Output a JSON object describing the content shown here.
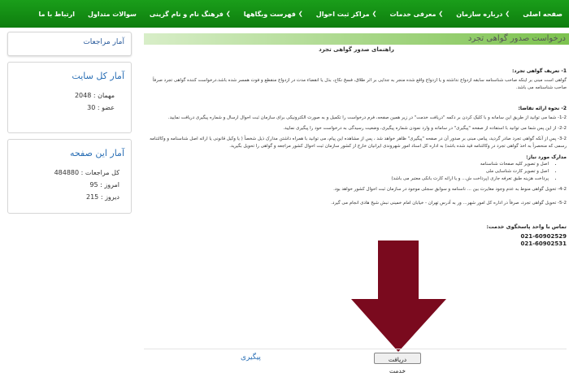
{
  "nav": {
    "items": [
      {
        "label": "صفحه اصلی",
        "chevron": false
      },
      {
        "label": "درباره سازمان",
        "chevron": true
      },
      {
        "label": "معرفی خدمات",
        "chevron": true
      },
      {
        "label": "مراکز ثبت احوال",
        "chevron": true
      },
      {
        "label": "فهرست وبگاهها",
        "chevron": true
      },
      {
        "label": "فرهنگ نام و نام گزینی",
        "chevron": true
      },
      {
        "label": "سوالات متداول",
        "chevron": false
      },
      {
        "label": "ارتباط با ما",
        "chevron": false
      }
    ],
    "color": "#129012"
  },
  "sidebar": {
    "visits_title": "آمار مراجعات",
    "site_stats": {
      "title": "آمار کل سایت",
      "guests_label": "مهمان :",
      "guests_value": "2048",
      "members_label": "عضو :",
      "members_value": "30"
    },
    "page_stats": {
      "title": "آمار این صفحه",
      "total_label": "کل مراجعات :",
      "total_value": "484880",
      "today_label": "امروز :",
      "today_value": "95",
      "yesterday_label": "دیروز :",
      "yesterday_value": "215"
    }
  },
  "main": {
    "title": "درخواست صدور گواهی تجرد",
    "subtitle": "راهنمای صدور گواهی تجرد",
    "s1_title": "1- تعریف گواهی تجرد:",
    "s1_text": "گواهی است مبنی بر اینکه صاحب شناسنامه سابقه ازدواج نداشته و یا ازدواج واقع شده منجر به جدایی بر اثر طلاق، فسخ نکاح، بذل یا انقضاء مدت در ازدواج منقطع و فوت همسر شده باشد.درخواست کننده گواهی تجرد صرفاً صاحب شناسنامه می باشد.",
    "s2_title": "2- نحوه ارائه تقاضا:",
    "s21": "1-2- شما می توانید از طریق این سامانه و با کلیک کردن بر دکمه \"دریافت خدمت\" در زیر همین صفحه، فرم درخواست را تکمیل و به صورت الکترونیکی برای سازمان ثبت احوال ارسال و شماره پیگیری دریافت نمایید.",
    "s22": "2-2- از این پس شما می توانید با استفاده از صفحه \"پیگیری\" در سامانه و وارد نمودن شماره پیگیری، وضعیت رسیدگی به درخواست خود را پیگیری نمایید.",
    "s23": "3-2- پس از آنکه گواهی تجرد صادر گردید، پیامی مبنی بر صدور آن در صفحه \"پیگیری\" ظاهر خواهد شد ، پس از مشاهده این پیام، می توانید با همراه داشتن مدارک ذیل شخصاً ( یا وکیل قانونی یا ارائه اصل شناسنامه و وکالتنامه رسمی که منحصراً به اخذ گواهی تجرد در وکالتنامه قید شده باشد) به اداره کل اسناد امور شهروندی ایرانیان خارج از کشور سازمان ثبت احوال کشور مراجعه و گواهی را تحویل بگیرید.",
    "docs_title": "مدارک مورد نیاز:",
    "docs": [
      "اصل و تصویر کلیه صفحات شناسنامه",
      "اصل و تصویر کارت شناسایی ملی",
      "پرداخت هزینه طبق تعرفه جاری (پرداخت ش... و یا ارائه کارت بانکی معتبر می باشد)"
    ],
    "s24": "4-2- تحویل گواهی منوط به عدم وجود مغایرت بین ... ناسنامه و سوابق سجلی موجود در سازمان ثبت احوال کشور خواهد بود.",
    "s25": "5-2- تحویل گواهی تجرد، صرفاً در اداره کل امور شهر... ور به آدرس تهران - خیابان امام خمینی نبش شیخ هادی انجام می گیرد.",
    "contact_title": "تماس با واحد پاسخگوی خدمت:",
    "phone1": "021-60902529",
    "phone2": "021-60902531",
    "receive_button": "دریافت خدمت",
    "track_link": "پیگیری"
  },
  "arrow_color": "#7a0a1e"
}
